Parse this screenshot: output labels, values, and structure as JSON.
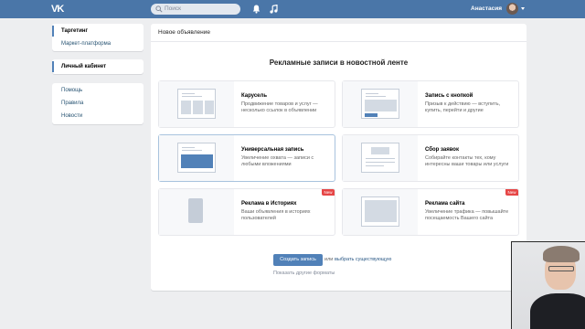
{
  "topbar": {
    "logo": "VK",
    "search_placeholder": "Поиск",
    "user_name": "Анастасия"
  },
  "sidebar": {
    "group1": [
      "Таргетинг",
      "Маркет-платформа"
    ],
    "group2": [
      "Личный кабинет"
    ],
    "group3": [
      "Помощь",
      "Правила",
      "Новости"
    ],
    "active": [
      "Таргетинг",
      "Личный кабинет"
    ]
  },
  "main": {
    "title": "Новое объявление",
    "section_title": "Рекламные записи в новостной ленте",
    "cards": [
      {
        "title": "Карусель",
        "desc": "Продвижение товаров и услуг — несколько ссылок в объявлении",
        "badge": "",
        "selected": false
      },
      {
        "title": "Запись с кнопкой",
        "desc": "Призыв к действию — вступить, купить, перейти и другие",
        "badge": "",
        "selected": false
      },
      {
        "title": "Универсальная запись",
        "desc": "Увеличение охвата — записи с любыми вложениями",
        "badge": "",
        "selected": true
      },
      {
        "title": "Сбор заявок",
        "desc": "Собирайте контакты тех, кому интересны ваши товары или услуги",
        "badge": "",
        "selected": false
      },
      {
        "title": "Реклама в Историях",
        "desc": "Ваши объявления в историях пользователей",
        "badge": "New",
        "selected": false
      },
      {
        "title": "Реклама сайта",
        "desc": "Увеличение трафика — повышайте посещаемость Вашего сайта",
        "badge": "New",
        "selected": false
      }
    ],
    "create_button": "Создать запись",
    "or_text": "или",
    "choose_link": "выбрать существующую",
    "other_formats_link": "Показать другие форматы"
  },
  "colors": {
    "accent": "#4a76a8",
    "button": "#5181b8",
    "badge": "#e64646",
    "link": "#2a5885"
  }
}
